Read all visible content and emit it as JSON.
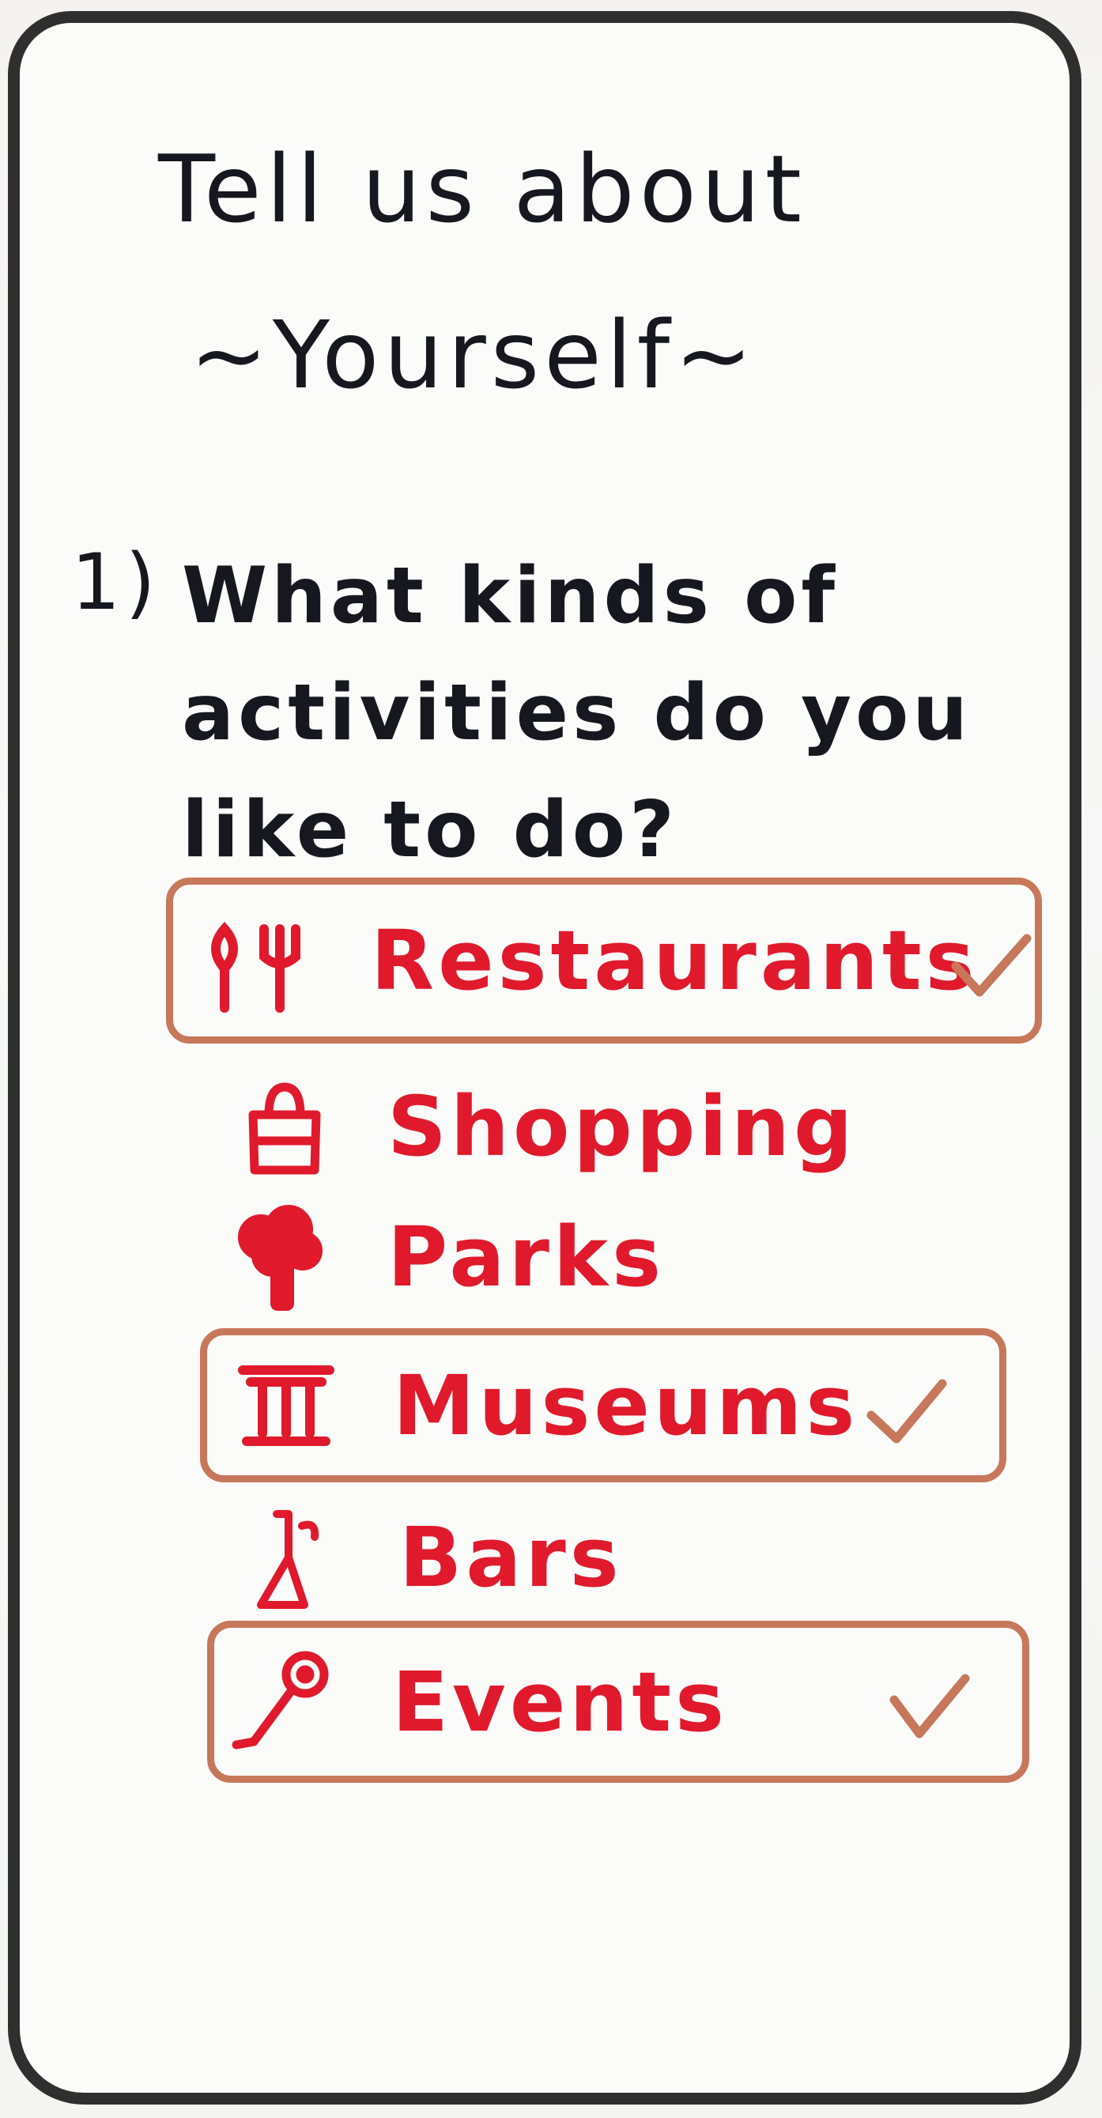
{
  "header": {
    "title_line1": "Tell us about",
    "title_line2": "~Yourself~"
  },
  "question": {
    "number": "1)",
    "text": "What kinds of activities do you like to do?"
  },
  "colors": {
    "ink": "#17171f",
    "option_text": "#e01a2c",
    "selection_border": "#c7785a"
  },
  "options": [
    {
      "label": "Restaurants",
      "icon": "fork-knife-icon",
      "selected": true
    },
    {
      "label": "Shopping",
      "icon": "shopping-bag-icon",
      "selected": false
    },
    {
      "label": "Parks",
      "icon": "tree-icon",
      "selected": false
    },
    {
      "label": "Museums",
      "icon": "museum-icon",
      "selected": true
    },
    {
      "label": "Bars",
      "icon": "cocktail-glass-icon",
      "selected": false
    },
    {
      "label": "Events",
      "icon": "microphone-icon",
      "selected": true
    }
  ]
}
